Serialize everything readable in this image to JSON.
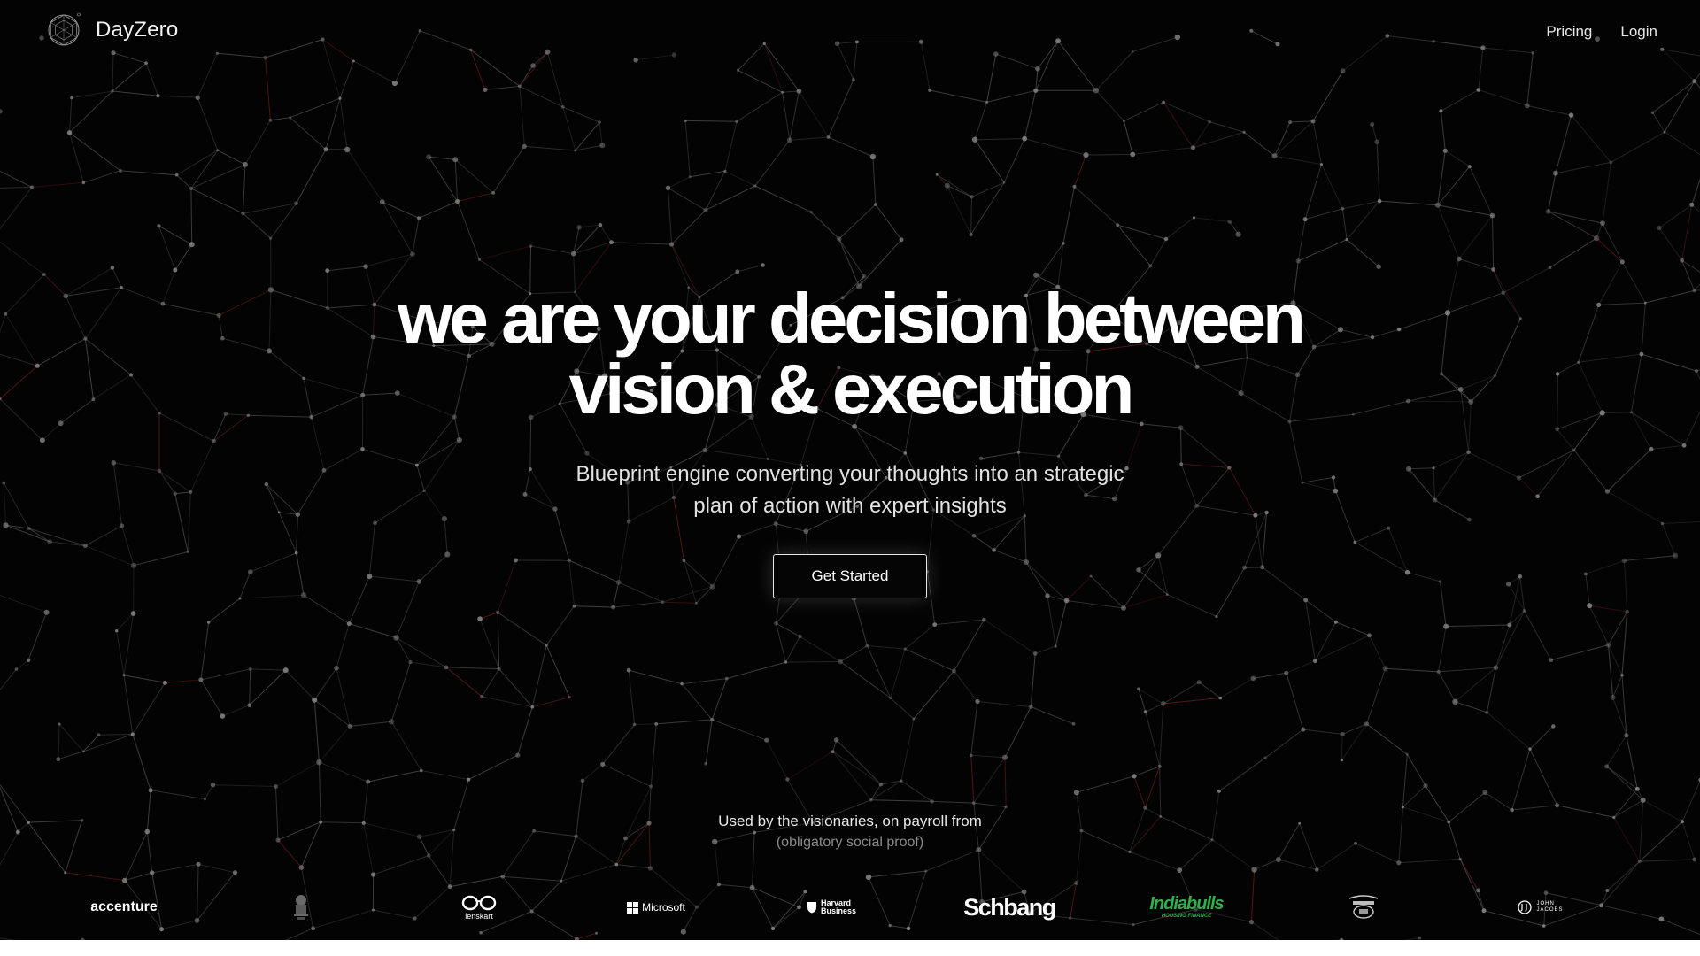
{
  "brand": {
    "name": "DayZero",
    "logo_icon": "geodesic-globe-icon"
  },
  "nav": {
    "pricing": "Pricing",
    "login": "Login"
  },
  "hero": {
    "headline_line1": "we are your decision between",
    "headline_line2": "vision & execution",
    "subhead_line1": "Blueprint engine converting your thoughts into an strategic",
    "subhead_line2": "plan of action with expert insights",
    "cta_label": "Get Started"
  },
  "social_proof": {
    "title": "Used by the visionaries, on payroll from",
    "subtitle": "(obligatory social proof)",
    "logos": {
      "accenture": "accenture",
      "emblem": "government-emblem-icon",
      "lenskart": "lenskart",
      "microsoft": "Microsoft",
      "harvard_line1": "Harvard",
      "harvard_line2": "Business",
      "schbang": "Schbang",
      "indiabulls": "Indiabulls",
      "indiabulls_sub": "HOUSING FINANCE",
      "jackdaniels": "jack-daniels-label-icon",
      "johnjacobs_line1": "JOHN",
      "johnjacobs_line2": "JACOBS"
    }
  },
  "colors": {
    "background": "#030303",
    "text": "#ffffff",
    "muted": "#8a8a8a",
    "network_line": "#5a5a5a",
    "network_accent": "#7a1f1f",
    "indiabulls_green": "#2fb04d",
    "accenture_accent": "#a100ff"
  }
}
